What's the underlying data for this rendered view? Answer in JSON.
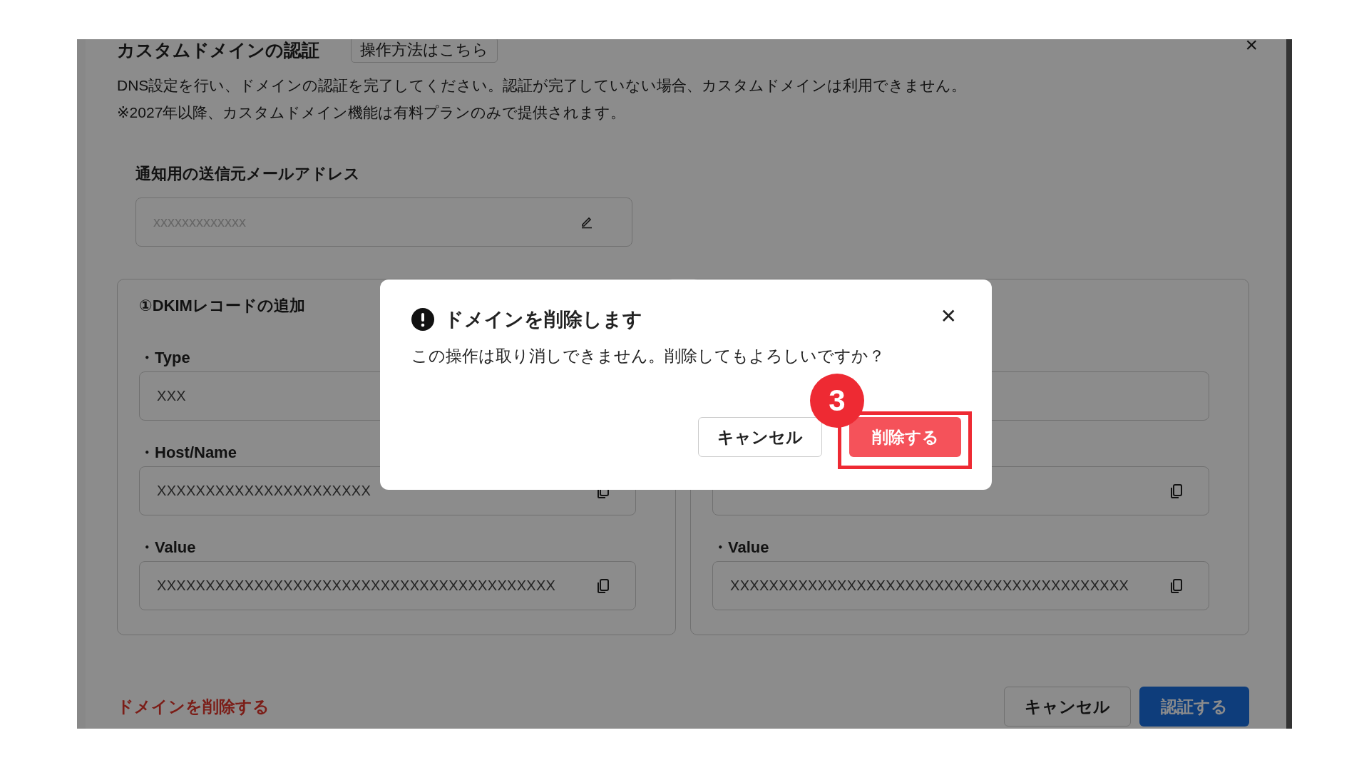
{
  "panel": {
    "title": "カスタムドメインの認証",
    "guide_button": "操作方法はこちら",
    "close": "×",
    "description": [
      "DNS設定を行い、ドメインの認証を完了してください。認証が完了していない場合、カスタムドメインは利用できません。",
      "※2027年以降、カスタムドメイン機能は有料プランのみで提供されます。"
    ],
    "email": {
      "label": "通知用の送信元メールアドレス",
      "placeholder": "xxxxxxxxxxxxx"
    },
    "cards": [
      {
        "title": "①DKIMレコードの追加",
        "fields": [
          {
            "label": "・Type",
            "value": "XXX"
          },
          {
            "label": "・Host/Name",
            "value": "XXXXXXXXXXXXXXXXXXXXXX",
            "copy": true
          },
          {
            "label": "・Value",
            "value": "XXXXXXXXXXXXXXXXXXXXXXXXXXXXXXXXXXXXXXXXX",
            "copy": true
          }
        ]
      },
      {
        "fields": [
          {
            "copy": false
          },
          {
            "copy": true
          },
          {
            "label": "・Value",
            "value": "XXXXXXXXXXXXXXXXXXXXXXXXXXXXXXXXXXXXXXXXX",
            "copy": true
          }
        ]
      }
    ],
    "delete_link": "ドメインを削除する",
    "cancel_button": "キャンセル",
    "verify_button": "認証する"
  },
  "dialog": {
    "title": "ドメインを削除します",
    "message": "この操作は取り消しできません。削除してもよろしいですか？",
    "cancel_button": "キャンセル",
    "confirm_button": "削除する",
    "close": "✕"
  },
  "step_badge": "3"
}
